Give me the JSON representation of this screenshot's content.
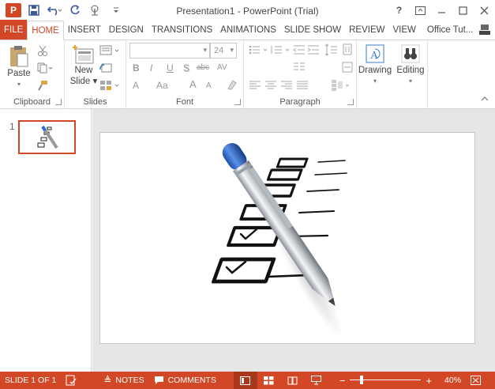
{
  "app": {
    "title": "Presentation1 - PowerPoint (Trial)",
    "logo_letter": "P",
    "accent_color": "#d24726"
  },
  "quick_access": {
    "icons": [
      "save-icon",
      "undo-icon",
      "redo-icon",
      "touch-mode-icon",
      "customize-icon"
    ]
  },
  "window_controls": {
    "help": "?",
    "icons": [
      "help-icon",
      "ribbon-display-icon",
      "minimize-icon",
      "maximize-icon",
      "close-icon"
    ]
  },
  "tabs": {
    "file": "FILE",
    "items": [
      "HOME",
      "INSERT",
      "DESIGN",
      "TRANSITIONS",
      "ANIMATIONS",
      "SLIDE SHOW",
      "REVIEW",
      "VIEW"
    ],
    "active": "HOME",
    "account": "Office Tut..."
  },
  "ribbon": {
    "clipboard": {
      "label": "Clipboard",
      "paste": "Paste"
    },
    "slides": {
      "label": "Slides",
      "new_slide_1": "New",
      "new_slide_2": "Slide"
    },
    "font": {
      "label": "Font",
      "font_name": "",
      "font_size": "24",
      "buttons": [
        "B",
        "I",
        "U",
        "S",
        "abc",
        "AV"
      ],
      "row3": [
        "A",
        "Aa",
        "A",
        "A"
      ]
    },
    "paragraph": {
      "label": "Paragraph"
    },
    "drawing": {
      "label": "Drawing"
    },
    "editing": {
      "label": "Editing"
    }
  },
  "slide_pane": {
    "slide_number": "1"
  },
  "status": {
    "slide_info": "SLIDE 1 OF 1",
    "notes": "NOTES",
    "comments": "COMMENTS",
    "zoom": "40%",
    "zoom_level_percent": 40,
    "minus": "−",
    "plus": "+"
  }
}
